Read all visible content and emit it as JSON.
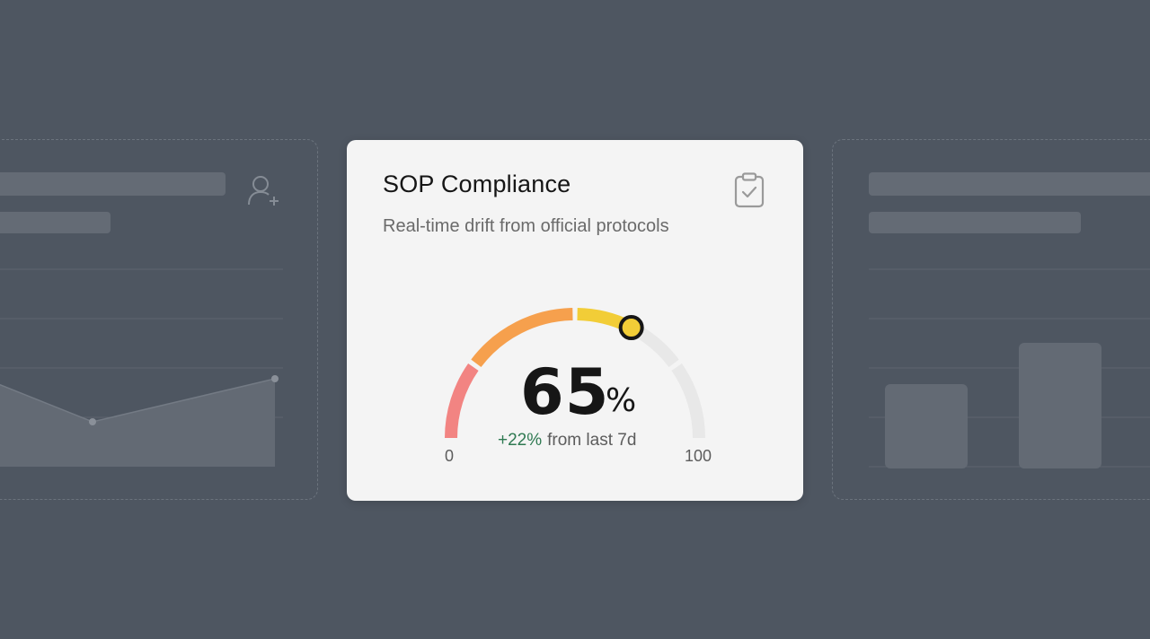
{
  "card": {
    "title": "SOP Compliance",
    "subtitle": "Real-time drift from official protocols",
    "icon": "clipboard-check-icon"
  },
  "gauge": {
    "value": 65,
    "unit": "%",
    "min": 0,
    "max": 100,
    "delta": "+22%",
    "delta_text": "from last 7d",
    "min_label": "0",
    "max_label": "100",
    "segment_colors": [
      "#f28482",
      "#f6a04d",
      "#f2cd37",
      "#e8e8e8",
      "#e8e8e8"
    ],
    "marker_color": "#f2cd37",
    "delta_color": "#2f7a52"
  },
  "ghost_left": {
    "icon": "add-user-icon"
  }
}
